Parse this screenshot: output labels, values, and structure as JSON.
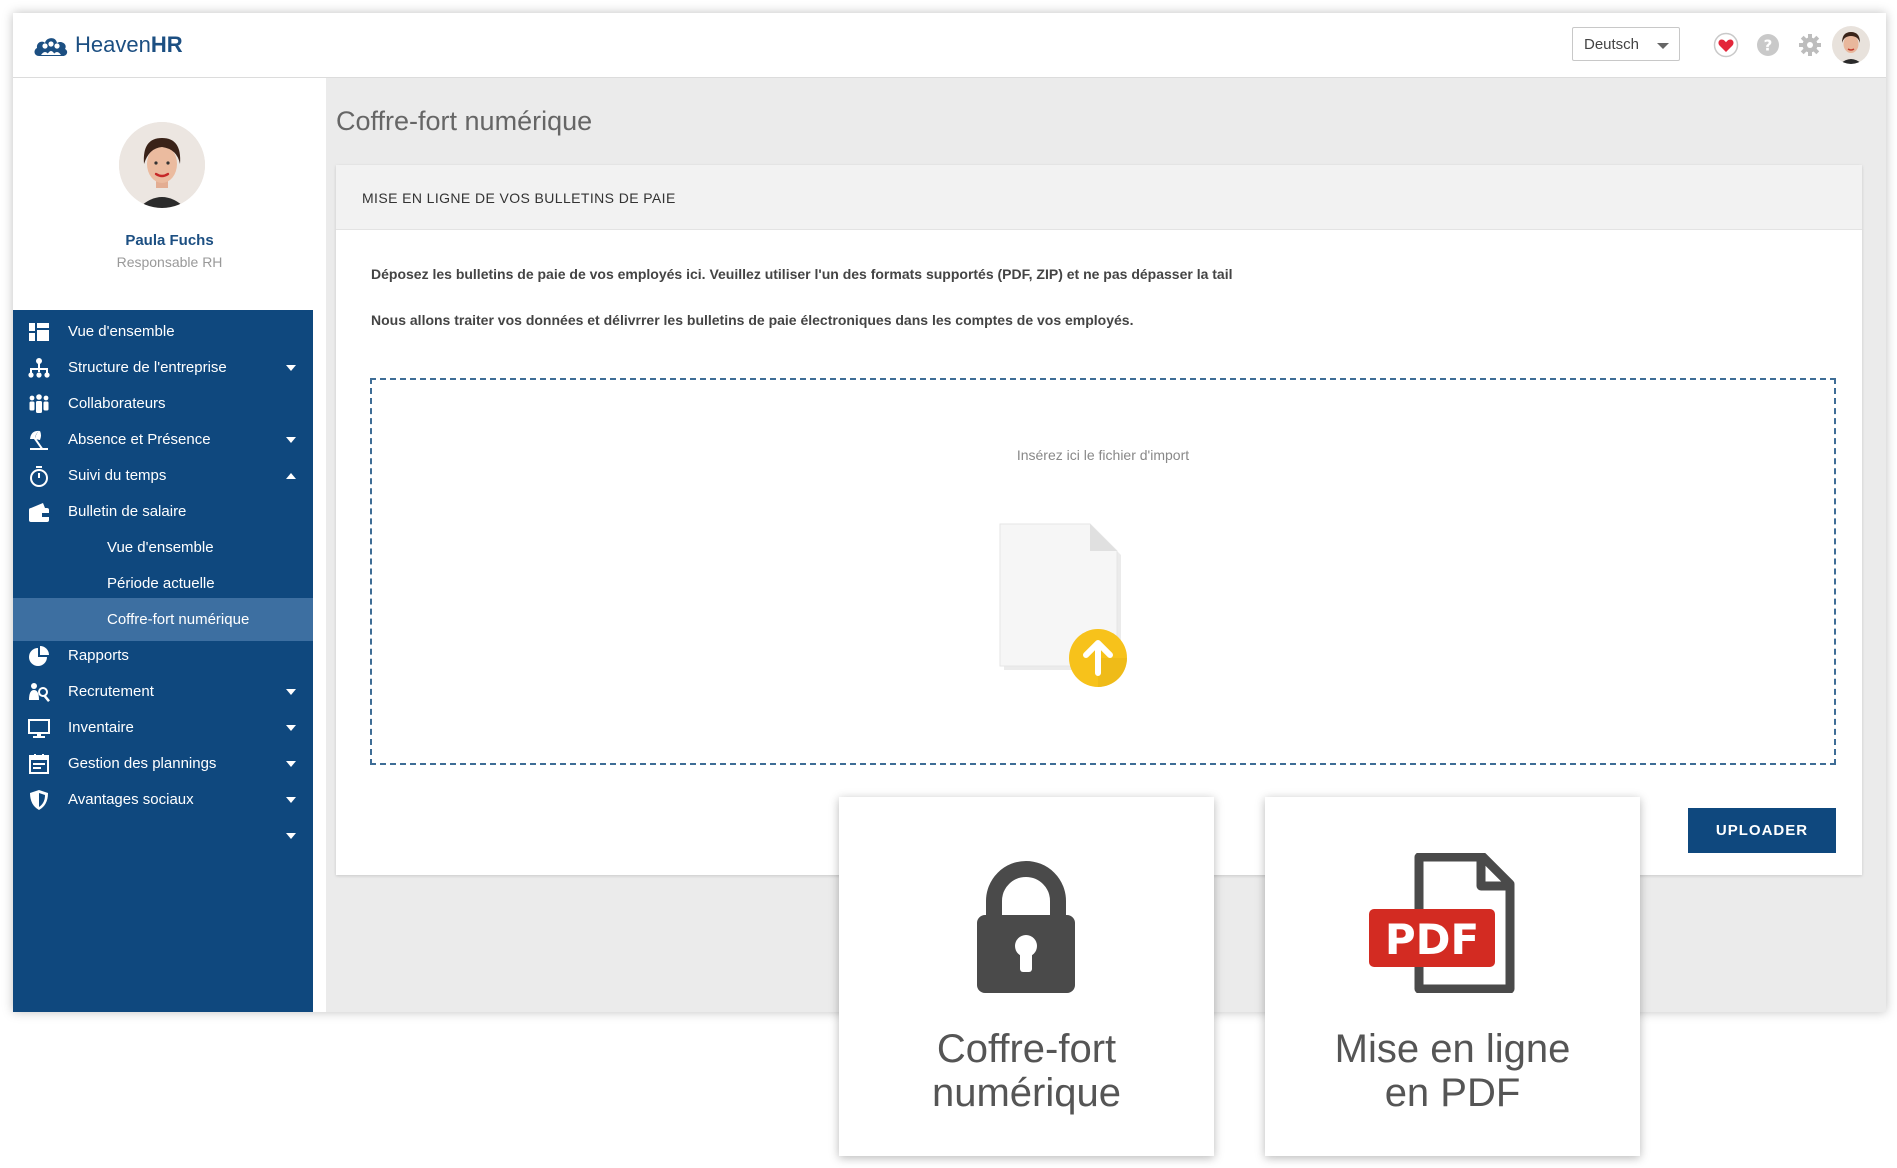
{
  "header": {
    "logo_prefix": "Heaven",
    "logo_suffix": "HR",
    "language": "Deutsch"
  },
  "profile": {
    "name": "Paula Fuchs",
    "role": "Responsable RH"
  },
  "nav": [
    {
      "label": "Vue d'ensemble",
      "icon": "dashboard-icon"
    },
    {
      "label": "Structure de l'entreprise",
      "icon": "org-chart-icon"
    },
    {
      "label": "Collaborateurs",
      "icon": "people-icon"
    },
    {
      "label": "Absence et Présence",
      "icon": "beach-umbrella-icon"
    },
    {
      "label": "Suivi du temps",
      "icon": "stopwatch-icon"
    },
    {
      "label": "Bulletin de salaire",
      "icon": "wallet-icon"
    },
    {
      "label": "Vue d'ensemble"
    },
    {
      "label": "Période actuelle"
    },
    {
      "label": "Coffre-fort numérique"
    },
    {
      "label": "Rapports",
      "icon": "pie-chart-icon"
    },
    {
      "label": "Recrutement",
      "icon": "recruitment-icon"
    },
    {
      "label": "Inventaire",
      "icon": "monitor-icon"
    },
    {
      "label": "Gestion des plannings",
      "icon": "calendar-icon"
    },
    {
      "label": "Avantages sociaux",
      "icon": "shield-icon"
    }
  ],
  "main": {
    "page_title": "Coffre-fort numérique",
    "panel_title": "MISE EN LIGNE DE VOS BULLETINS DE PAIE",
    "paragraph_1": "Déposez les bulletins de paie de vos employés ici. Veuillez utiliser l'un des formats supportés (PDF, ZIP) et ne pas dépasser la tail",
    "paragraph_2": "Nous allons traiter vos données et délivrrer les bulletins de paie électroniques dans les comptes de vos employés.",
    "dropzone_text": "Insérez ici le fichier d'import",
    "upload_button": "UPLOADER"
  },
  "cards": [
    {
      "line1": "Coffre-fort",
      "line2": "numérique",
      "icon": "lock-icon"
    },
    {
      "line1": "Mise en ligne",
      "line2": "en PDF",
      "icon": "pdf-file-icon",
      "badge": "PDF"
    }
  ],
  "colors": {
    "brand": "#0f487e",
    "active_nav": "#3d6fa1",
    "pdf_red": "#d32b22",
    "upload_yellow": "#f7c21b",
    "heart_red": "#e3263a"
  }
}
